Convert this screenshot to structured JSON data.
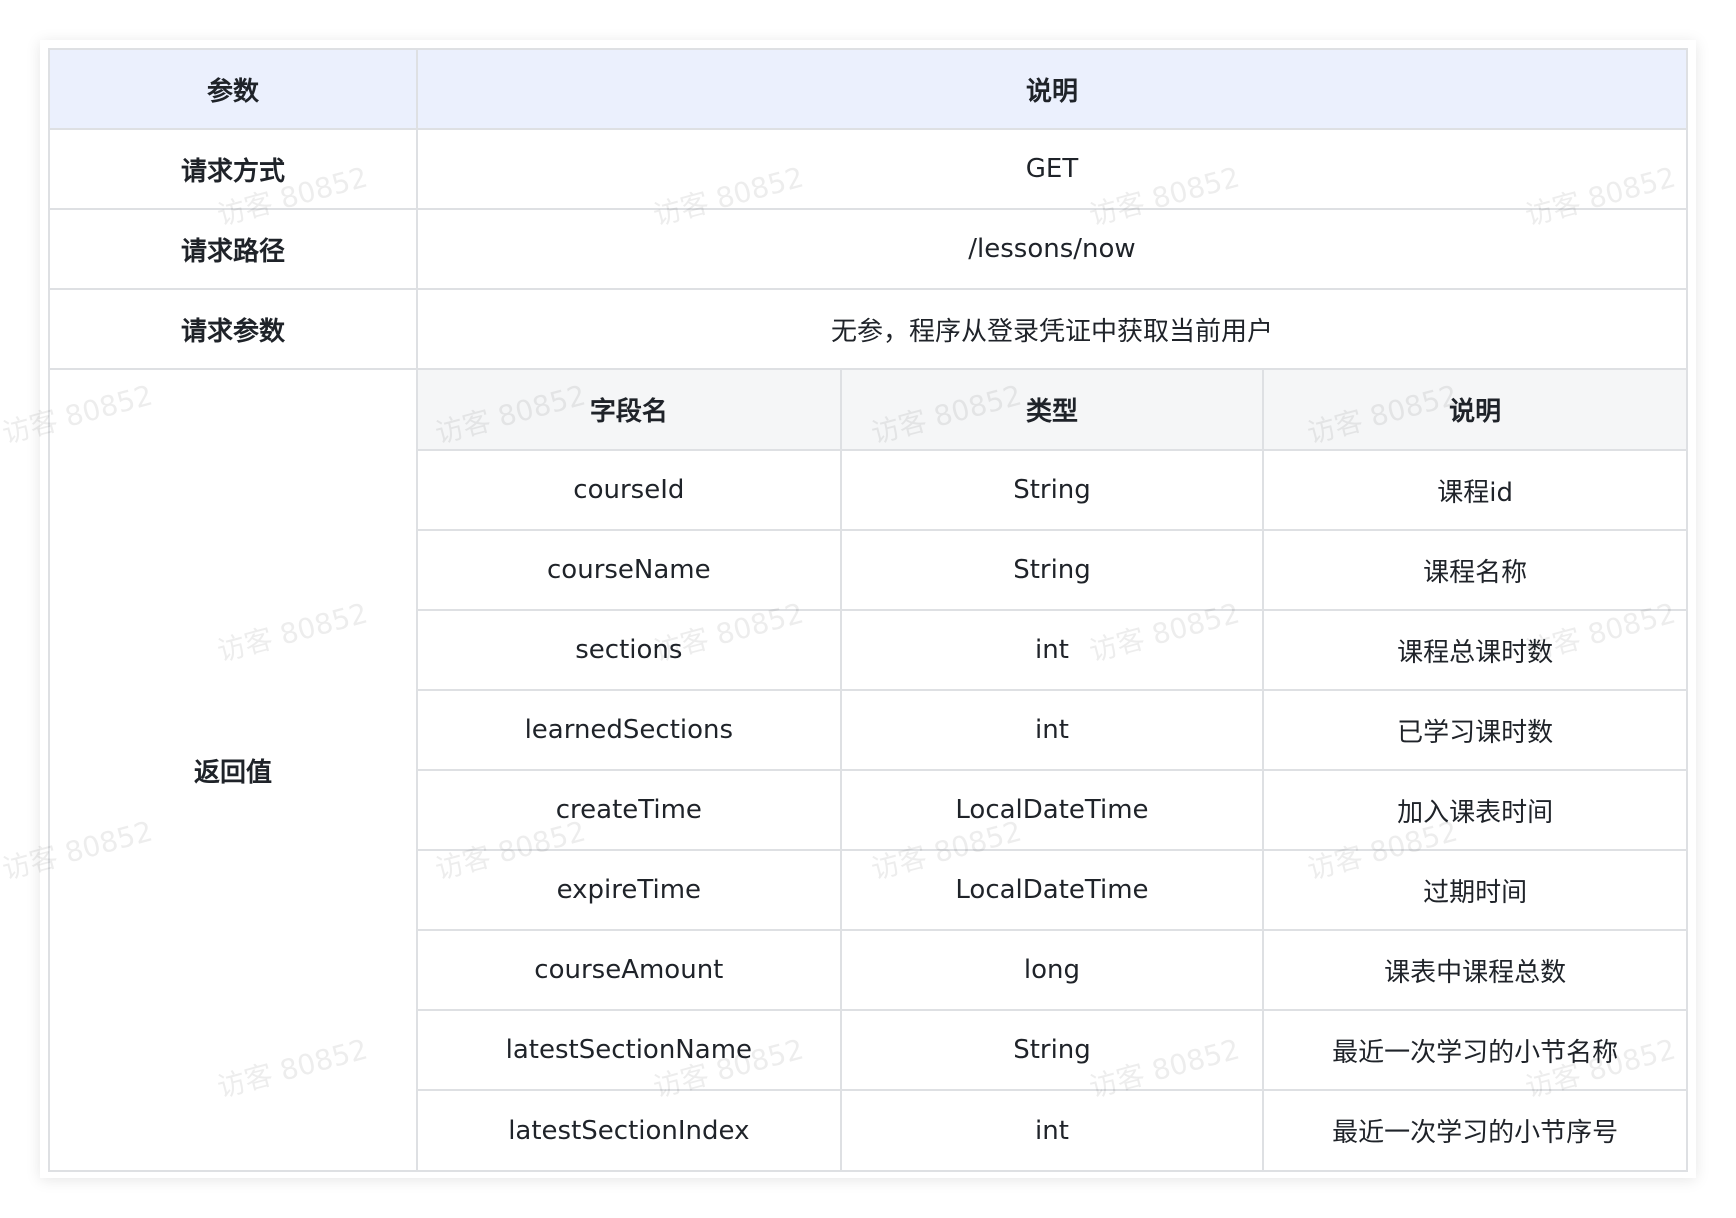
{
  "header": {
    "param": "参数",
    "desc": "说明"
  },
  "rows": {
    "method": {
      "label": "请求方式",
      "value": "GET"
    },
    "path": {
      "label": "请求路径",
      "value": "/lessons/now"
    },
    "params": {
      "label": "请求参数",
      "value": "无参，程序从登录凭证中获取当前用户"
    },
    "return": {
      "label": "返回值"
    }
  },
  "inner": {
    "headers": [
      "字段名",
      "类型",
      "说明"
    ],
    "rows": [
      [
        "courseId",
        "String",
        "课程id"
      ],
      [
        "courseName",
        "String",
        "课程名称"
      ],
      [
        "sections",
        "int",
        "课程总课时数"
      ],
      [
        "learnedSections",
        "int",
        "已学习课时数"
      ],
      [
        "createTime",
        "LocalDateTime",
        "加入课表时间"
      ],
      [
        "expireTime",
        "LocalDateTime",
        "过期时间"
      ],
      [
        "courseAmount",
        "long",
        "课表中课程总数"
      ],
      [
        "latestSectionName",
        "String",
        "最近一次学习的小节名称"
      ],
      [
        "latestSectionIndex",
        "int",
        "最近一次学习的小节序号"
      ]
    ]
  },
  "watermark": "访客 80852"
}
